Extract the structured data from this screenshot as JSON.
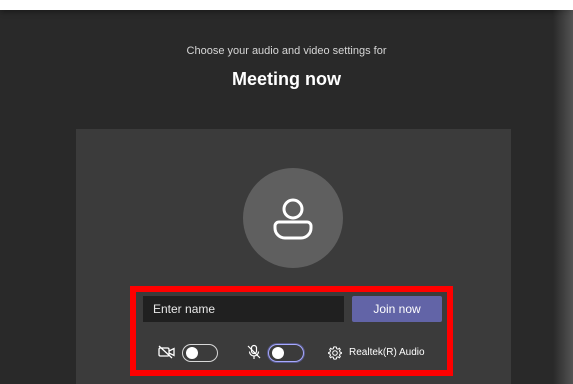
{
  "header": {
    "subtitle": "Choose your audio and video settings for",
    "meeting_title": "Meeting now"
  },
  "join_panel": {
    "name_placeholder": "Enter name",
    "join_label": "Join now",
    "camera_toggle": {
      "icon": "camera-off-icon",
      "state": "off"
    },
    "mic_toggle": {
      "icon": "mic-off-icon",
      "state": "off",
      "focused": true
    },
    "audio_settings": {
      "icon": "gear-icon",
      "device": "Realtek(R) Audio"
    }
  },
  "colors": {
    "background": "#292929",
    "preview": "#3b3b3b",
    "avatar": "#5f5f5f",
    "join_button": "#6264a7",
    "highlight": "#ff0000"
  }
}
